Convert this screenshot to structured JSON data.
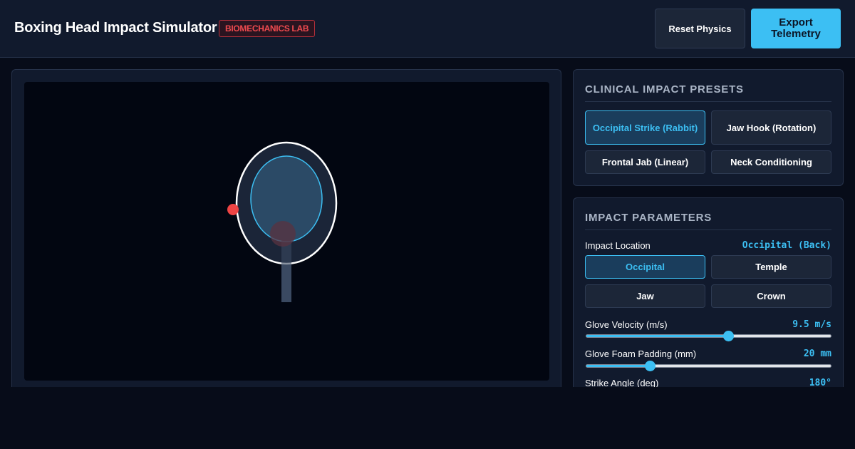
{
  "header": {
    "title": "Boxing Head Impact Simulator",
    "badge": "BIOMECHANICS LAB",
    "reset_label": "Reset Physics",
    "export_label": "Export Telemetry"
  },
  "presets": {
    "title": "CLINICAL IMPACT PRESETS",
    "items": [
      {
        "label": "Occipital Strike (Rabbit)",
        "active": true
      },
      {
        "label": "Jaw Hook (Rotation)",
        "active": false
      },
      {
        "label": "Frontal Jab (Linear)",
        "active": false
      },
      {
        "label": "Neck Conditioning",
        "active": false
      }
    ]
  },
  "parameters": {
    "title": "IMPACT PARAMETERS",
    "location": {
      "label": "Impact Location",
      "value": "Occipital (Back)",
      "options": [
        {
          "label": "Occipital",
          "active": true
        },
        {
          "label": "Temple",
          "active": false
        },
        {
          "label": "Jaw",
          "active": false
        },
        {
          "label": "Crown",
          "active": false
        }
      ]
    },
    "velocity": {
      "label": "Glove Velocity (m/s)",
      "value": "9.5 m/s",
      "fraction": 0.58
    },
    "padding": {
      "label": "Glove Foam Padding (mm)",
      "value": "20 mm",
      "fraction": 0.26
    },
    "angle": {
      "label": "Strike Angle (deg)",
      "value": "180°"
    }
  },
  "colors": {
    "accent": "#3cbff3",
    "impact": "#ef4444",
    "skull": "#ffffff"
  }
}
